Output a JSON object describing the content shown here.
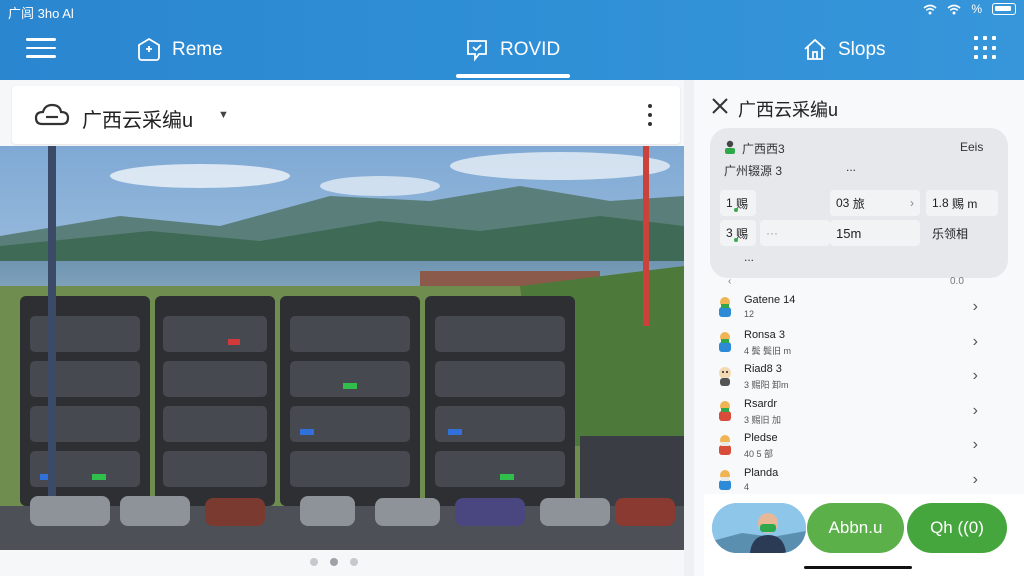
{
  "status_bar": {
    "left_text": "广闾 3ho Al",
    "battery_text": "%"
  },
  "nav": {
    "tabs": [
      {
        "label": "Reme",
        "icon": "home-shield-icon"
      },
      {
        "label": "ROVID",
        "icon": "chat-shield-icon",
        "active": true
      },
      {
        "label": "Slops",
        "icon": "house-icon"
      }
    ]
  },
  "left_panel": {
    "title": "广西云采编u"
  },
  "carousel": {
    "pages": 3,
    "active_index": 1
  },
  "right_panel": {
    "title": "广西云采编u",
    "card": {
      "name": "广西西3",
      "tag": "Eeis",
      "subtitle": "广州辍源 3",
      "dots_note": "...",
      "stats": [
        {
          "k": "1",
          "label": "赐",
          "v": "03",
          "v_label": "旅"
        },
        {
          "v": "1.8",
          "v_label": "赐 m"
        },
        {
          "k": "3",
          "label": "赐",
          "v": "15m"
        },
        {
          "v": "乐领相"
        }
      ],
      "dots_row": "...",
      "foot_left": "‹",
      "foot_right": "0.0"
    },
    "list": [
      {
        "name": "Gatene 14",
        "sub": "12"
      },
      {
        "name": "Ronsa 3",
        "sub": "4 鬓 鬓旧 m"
      },
      {
        "name": "Riad8 3",
        "sub": "3 赐阳 卸m"
      },
      {
        "name": "Rsardr",
        "sub": "3 赐旧 加"
      },
      {
        "name": "Pledse",
        "sub": "40 5 部"
      },
      {
        "name": "Planda",
        "sub": "4"
      }
    ]
  },
  "bottom_buttons": {
    "about": "Abbn.u",
    "qh": "Qh ((0)"
  },
  "colors": {
    "header_blue": "#2f8fd6",
    "green": "#5cb04a",
    "green_dark": "#46a63e"
  }
}
